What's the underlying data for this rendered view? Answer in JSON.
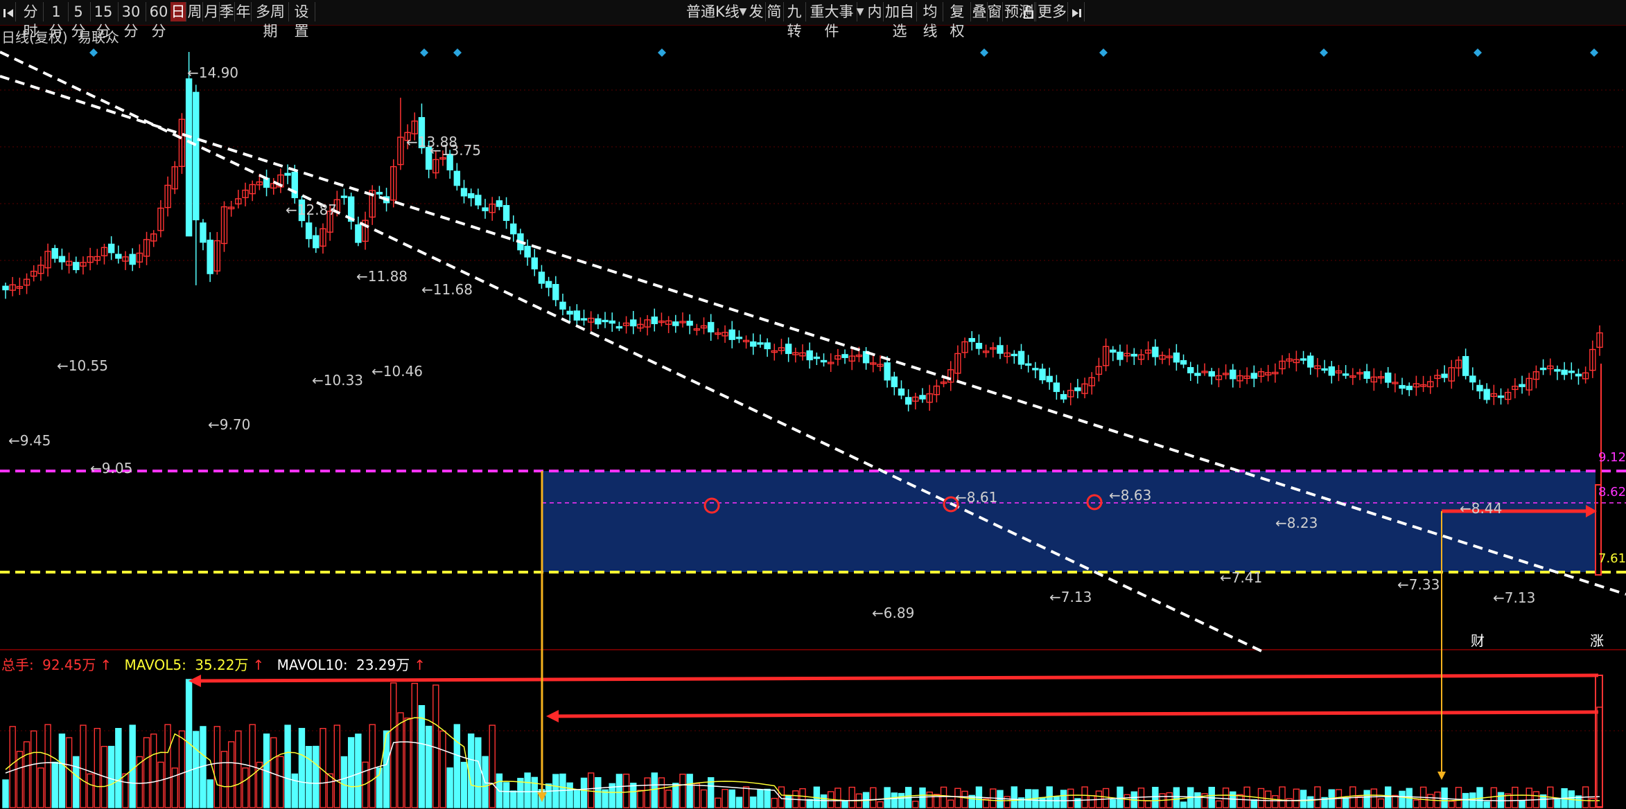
{
  "toolbar": {
    "left_items": [
      "分时",
      "1分",
      "5分",
      "15分",
      "30分",
      "60分",
      "日",
      "周",
      "月",
      "季",
      "年",
      "多周期",
      "设置"
    ],
    "active": "日",
    "kline_type": "普通K线",
    "right_items": [
      "发",
      "简",
      "九转",
      "重大事件",
      "内",
      "加自选",
      "均线",
      "复权",
      "叠",
      "窗",
      "预测",
      "更多"
    ],
    "icons": [
      "nav-first-icon",
      "lock-icon",
      "nav-last-icon"
    ]
  },
  "chart": {
    "title": "日线(复权)",
    "stock_name": "易联众",
    "price_labels": [
      "14.90",
      "13.88",
      "13.75",
      "12.87",
      "11.88",
      "11.68",
      "10.55",
      "10.46",
      "10.33",
      "9.70",
      "9.45",
      "9.05",
      "8.61",
      "8.63",
      "8.44",
      "8.23",
      "7.41",
      "7.33",
      "7.13",
      "7.13",
      "6.89"
    ],
    "axis_right": [
      "9.12",
      "8.62",
      "7.61"
    ],
    "event_markers": [
      "财",
      "涨"
    ]
  },
  "volume": {
    "total_label": "总手:",
    "total_value": "92.45万",
    "ma5_label": "MAVOL5:",
    "ma5_value": "35.22万",
    "ma10_label": "MAVOL10:",
    "ma10_value": "23.29万",
    "arrow": "↑"
  },
  "colors": {
    "background": "#000000",
    "up": "#ff3333",
    "down": "#54ffff",
    "band": "#0e2a66",
    "resistance": "#ff33ff",
    "support": "#ffff33",
    "trendline": "#ffffff",
    "annotation_arrow": "#ff2a2a",
    "vertical_line": "#f5b21e"
  }
}
